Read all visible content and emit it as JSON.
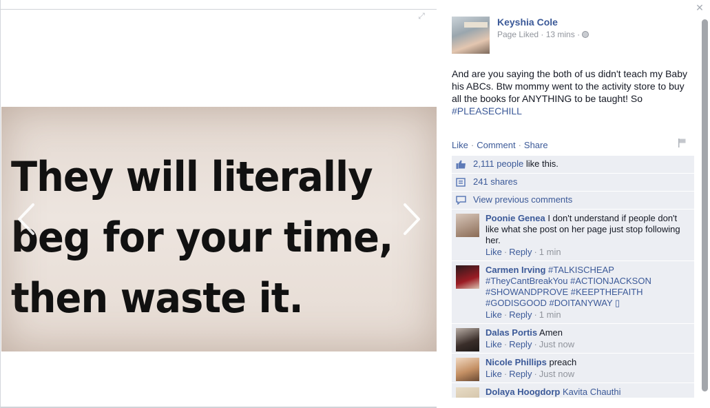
{
  "photo": {
    "lines": [
      "They will literally",
      "beg for your time,",
      "then waste it."
    ]
  },
  "post": {
    "author": "Keyshia Cole",
    "meta": "Page Liked · 13 mins ·",
    "text_plain": "And are you saying the both of us didn't teach my Baby his ABCs. Btw mommy went to the activity store to buy all the books for ANYTHING to be taught! So",
    "hashtag": "#PLEASECHILL",
    "avatar_label": "KEYSHIA COLE"
  },
  "actions": {
    "like": "Like",
    "comment": "Comment",
    "share": "Share"
  },
  "stats": {
    "likes_count": "2,111 people",
    "likes_suffix": " like this.",
    "shares": "241 shares",
    "view_previous": "View previous comments"
  },
  "comments": [
    {
      "name": "Poonie Genea",
      "text": " I don't understand if people don't like what she post on her page just stop following her.",
      "like": "Like",
      "reply": "Reply",
      "time": "1 min",
      "avatar_color": "#8a6b55"
    },
    {
      "name": "Carmen Irving",
      "text": " #TALKISCHEAP #TheyCantBreakYou #ACTIONJACKSON #SHOWANDPROVE #KEEPTHEFAITH #GODISGOOD #DOITANYWAY ▯",
      "like": "Like",
      "reply": "Reply",
      "time": "1 min",
      "avatar_color": "#9b1c24"
    },
    {
      "name": "Dalas Portis",
      "text": " Amen",
      "like": "Like",
      "reply": "Reply",
      "time": "Just now",
      "avatar_color": "#3a2e2a"
    },
    {
      "name": "Nicole Phillips",
      "text": " preach",
      "like": "Like",
      "reply": "Reply",
      "time": "Just now",
      "avatar_color": "#c49064"
    },
    {
      "name": "Dolaya Hoogdorp",
      "text": " Kavita Chauthi",
      "avatar_color": "#c9b79a"
    }
  ],
  "colors": {
    "link": "#3b5998",
    "muted": "#90949c",
    "ufi_bg": "#eceef3"
  }
}
